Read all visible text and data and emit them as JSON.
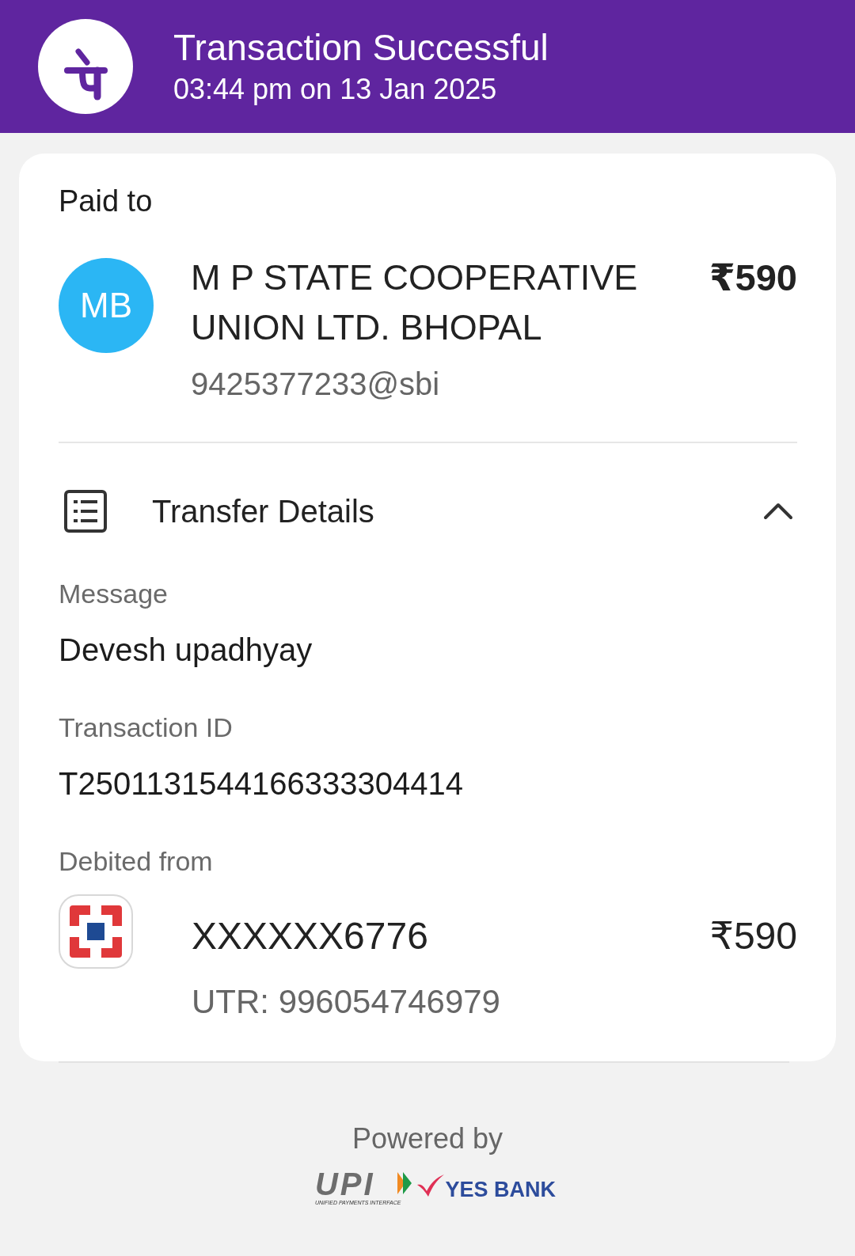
{
  "header": {
    "title": "Transaction Successful",
    "timestamp": "03:44 pm on 13 Jan 2025"
  },
  "paid_to": {
    "label": "Paid to",
    "avatar_initials": "MB",
    "name": "M P STATE COOPERATIVE UNION LTD. BHOPAL",
    "upi_id": "9425377233@sbi",
    "amount": "₹590"
  },
  "transfer_details": {
    "title": "Transfer Details",
    "expanded": true,
    "fields": [
      {
        "label": "Message",
        "value": "Devesh upadhyay"
      },
      {
        "label": "Transaction ID",
        "value": "T2501131544166333304414"
      }
    ],
    "debited_from": {
      "label": "Debited from",
      "account": "XXXXXX6776",
      "amount": "₹590",
      "utr": "UTR: 996054746979"
    }
  },
  "footer": {
    "powered_by": "Powered by",
    "logos": [
      {
        "kind": "upi",
        "text": "UPI",
        "tagline": "UNIFIED PAYMENTS INTERFACE"
      },
      {
        "kind": "bank",
        "text": "YES BANK"
      }
    ]
  }
}
